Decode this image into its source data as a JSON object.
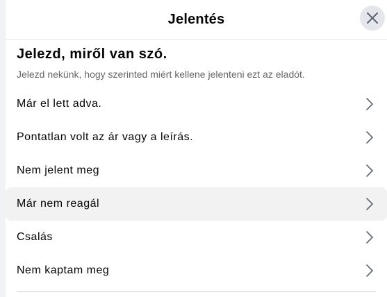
{
  "dialog": {
    "title": "Jelentés",
    "close_icon": "close-icon"
  },
  "section": {
    "heading": "Jelezd, miről van szó.",
    "subheading": "Jelezd nekünk, hogy szerinted miért kellene jelenteni ezt az eladót."
  },
  "options": [
    {
      "label": "Már el lett adva.",
      "icon": "chevron-right-icon"
    },
    {
      "label": "Pontatlan volt az ár vagy a leírás.",
      "icon": "chevron-right-icon"
    },
    {
      "label": "Nem jelent meg",
      "icon": "chevron-right-icon"
    },
    {
      "label": "Már nem reagál",
      "icon": "chevron-right-icon",
      "hovered": true
    },
    {
      "label": "Csalás",
      "icon": "chevron-right-icon"
    },
    {
      "label": "Nem kaptam meg",
      "icon": "chevron-right-icon"
    }
  ],
  "colors": {
    "text_primary": "#050505",
    "text_secondary": "#65676b",
    "hover_bg": "#f2f2f2",
    "close_bg": "#e4e6eb"
  }
}
